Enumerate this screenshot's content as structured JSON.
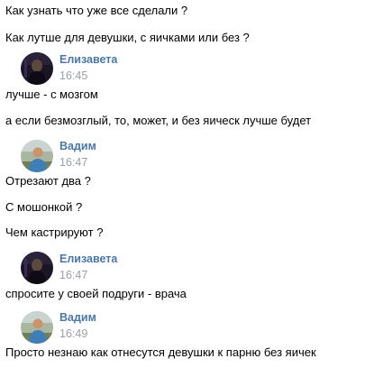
{
  "chat": {
    "lead_messages": [
      "Как узнать что уже все сделали ?",
      "Как лутше для девушки, с яичками или без ?"
    ],
    "groups": [
      {
        "author": "Елизавета",
        "time": "16:45",
        "avatar": "dark-portrait-avatar",
        "messages": [
          "лучше - с мозгом",
          "а если безмозглый, то, может, и без яическ лучше будет"
        ]
      },
      {
        "author": "Вадим",
        "time": "16:47",
        "avatar": "outdoor-portrait-avatar",
        "messages": [
          "Отрезают два ?",
          "С мошонкой ?",
          "Чем кастрируют ?"
        ]
      },
      {
        "author": "Елизавета",
        "time": "16:47",
        "avatar": "dark-portrait-avatar",
        "messages": [
          "спросите у своей подруги - врача"
        ]
      },
      {
        "author": "Вадим",
        "time": "16:49",
        "avatar": "outdoor-portrait-avatar",
        "messages": [
          "Просто незнаю как отнесутся девушки к парню без яичек"
        ]
      }
    ],
    "colors": {
      "author": "#4a76a8",
      "time": "#9a9fa6",
      "text": "#000000",
      "background": "#ffffff"
    }
  }
}
